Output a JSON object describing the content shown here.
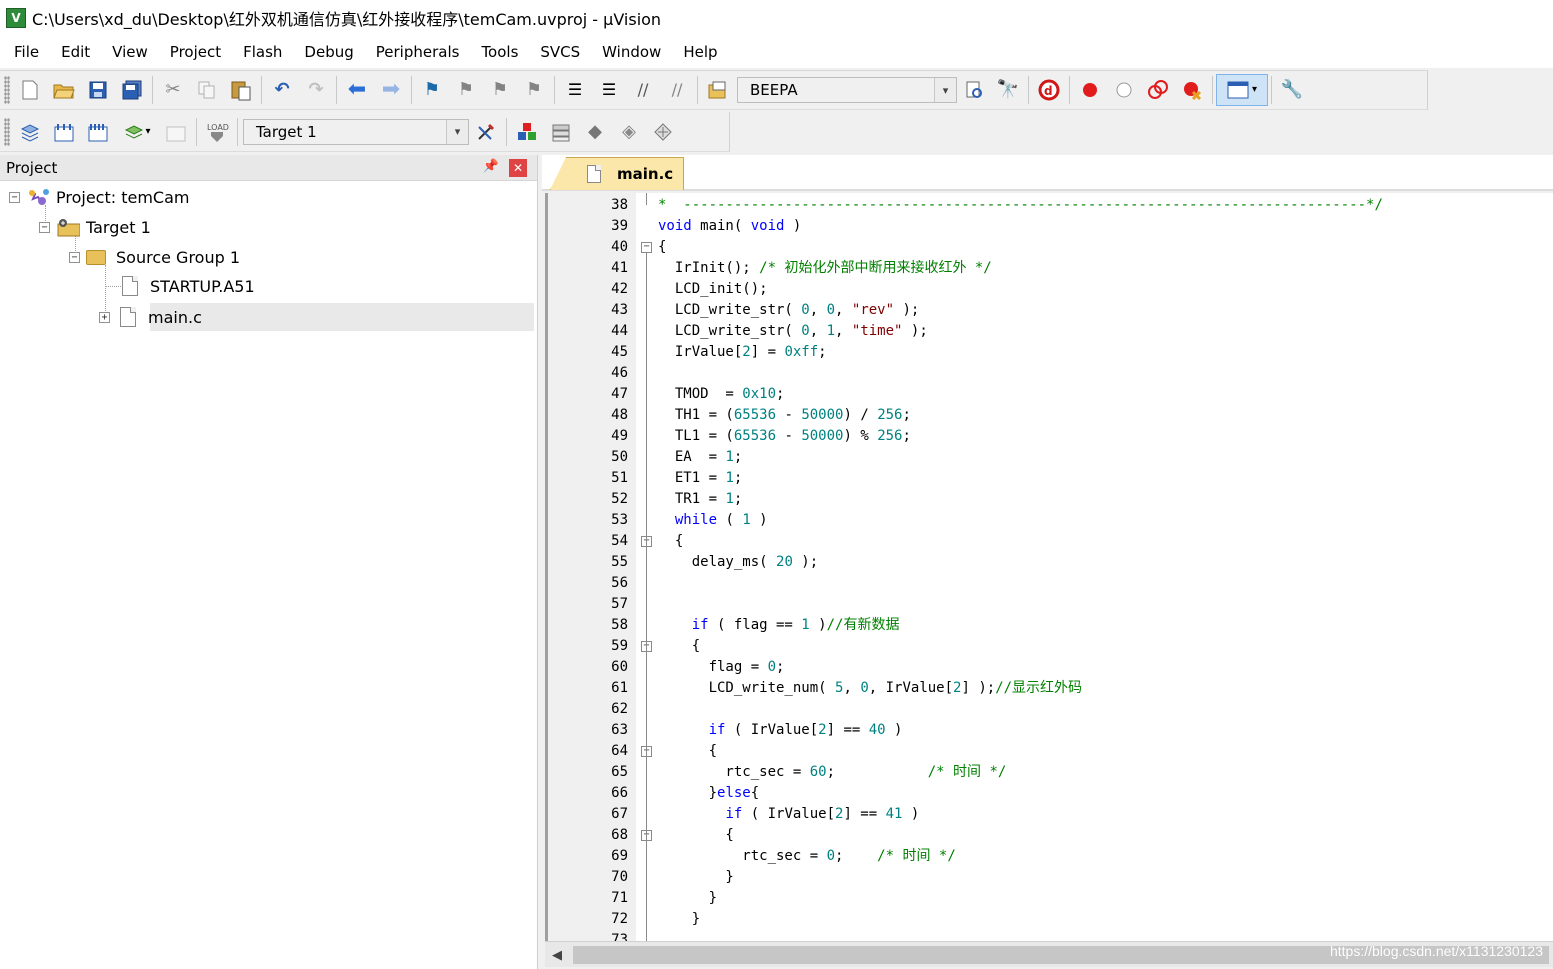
{
  "window": {
    "title": "C:\\Users\\xd_du\\Desktop\\红外双机通信仿真\\红外接收程序\\temCam.uvproj - µVision"
  },
  "menu": [
    "File",
    "Edit",
    "View",
    "Project",
    "Flash",
    "Debug",
    "Peripherals",
    "Tools",
    "SVCS",
    "Window",
    "Help"
  ],
  "toolbar1": {
    "find_combo_value": "BEEPA"
  },
  "toolbar2": {
    "target_combo_value": "Target 1"
  },
  "project_panel": {
    "title": "Project",
    "pin_glyph": "📌",
    "close_glyph": "✕",
    "tree": {
      "project": "Project: temCam",
      "target": "Target 1",
      "group": "Source Group 1",
      "files": [
        "STARTUP.A51",
        "main.c"
      ]
    }
  },
  "editor": {
    "tab_label": "main.c",
    "lines": [
      {
        "n": "38",
        "html": "<span class=\"cm\">*  ---------------------------------------------------------------------------------*/</span>"
      },
      {
        "n": "39",
        "html": "<span class=\"kw\">void</span> main( <span class=\"kw\">void</span> )"
      },
      {
        "n": "40",
        "html": "{"
      },
      {
        "n": "41",
        "html": "  IrInit(); <span class=\"cm\">/* 初始化外部中断用来接收红外 */</span>"
      },
      {
        "n": "42",
        "html": "  LCD_init();"
      },
      {
        "n": "43",
        "html": "  LCD_write_str( <span class=\"num\">0</span>, <span class=\"num\">0</span>, <span class=\"str\">\"rev\"</span> );"
      },
      {
        "n": "44",
        "html": "  LCD_write_str( <span class=\"num\">0</span>, <span class=\"num\">1</span>, <span class=\"str\">\"time\"</span> );"
      },
      {
        "n": "45",
        "html": "  IrValue[<span class=\"num\">2</span>] = <span class=\"num\">0xff</span>;"
      },
      {
        "n": "46",
        "html": ""
      },
      {
        "n": "47",
        "html": "  TMOD  = <span class=\"num\">0x10</span>;"
      },
      {
        "n": "48",
        "html": "  TH1 = (<span class=\"num\">65536</span> - <span class=\"num\">50000</span>) / <span class=\"num\">256</span>;"
      },
      {
        "n": "49",
        "html": "  TL1 = (<span class=\"num\">65536</span> - <span class=\"num\">50000</span>) % <span class=\"num\">256</span>;"
      },
      {
        "n": "50",
        "html": "  EA  = <span class=\"num\">1</span>;"
      },
      {
        "n": "51",
        "html": "  ET1 = <span class=\"num\">1</span>;"
      },
      {
        "n": "52",
        "html": "  TR1 = <span class=\"num\">1</span>;"
      },
      {
        "n": "53",
        "html": "  <span class=\"kw\">while</span> ( <span class=\"num\">1</span> )"
      },
      {
        "n": "54",
        "html": "  {"
      },
      {
        "n": "55",
        "html": "    delay_ms( <span class=\"num\">20</span> );"
      },
      {
        "n": "56",
        "html": ""
      },
      {
        "n": "57",
        "html": ""
      },
      {
        "n": "58",
        "html": "    <span class=\"kw\">if</span> ( flag == <span class=\"num\">1</span> )<span class=\"cm\">//有新数据</span>"
      },
      {
        "n": "59",
        "html": "    {"
      },
      {
        "n": "60",
        "html": "      flag = <span class=\"num\">0</span>;"
      },
      {
        "n": "61",
        "html": "      LCD_write_num( <span class=\"num\">5</span>, <span class=\"num\">0</span>, IrValue[<span class=\"num\">2</span>] );<span class=\"cm\">//显示红外码</span>"
      },
      {
        "n": "62",
        "html": ""
      },
      {
        "n": "63",
        "html": "      <span class=\"kw\">if</span> ( IrValue[<span class=\"num\">2</span>] == <span class=\"num\">40</span> )"
      },
      {
        "n": "64",
        "html": "      {"
      },
      {
        "n": "65",
        "html": "        rtc_sec = <span class=\"num\">60</span>;           <span class=\"cm\">/* 时间 */</span>"
      },
      {
        "n": "66",
        "html": "      }<span class=\"kw\">else</span>{"
      },
      {
        "n": "67",
        "html": "        <span class=\"kw\">if</span> ( IrValue[<span class=\"num\">2</span>] == <span class=\"num\">41</span> )"
      },
      {
        "n": "68",
        "html": "        {"
      },
      {
        "n": "69",
        "html": "          rtc_sec = <span class=\"num\">0</span>;    <span class=\"cm\">/* 时间 */</span>"
      },
      {
        "n": "70",
        "html": "        }"
      },
      {
        "n": "71",
        "html": "      }"
      },
      {
        "n": "72",
        "html": "    }"
      },
      {
        "n": "73",
        "html": ""
      }
    ]
  },
  "watermark": "https://blog.csdn.net/x1131230123"
}
